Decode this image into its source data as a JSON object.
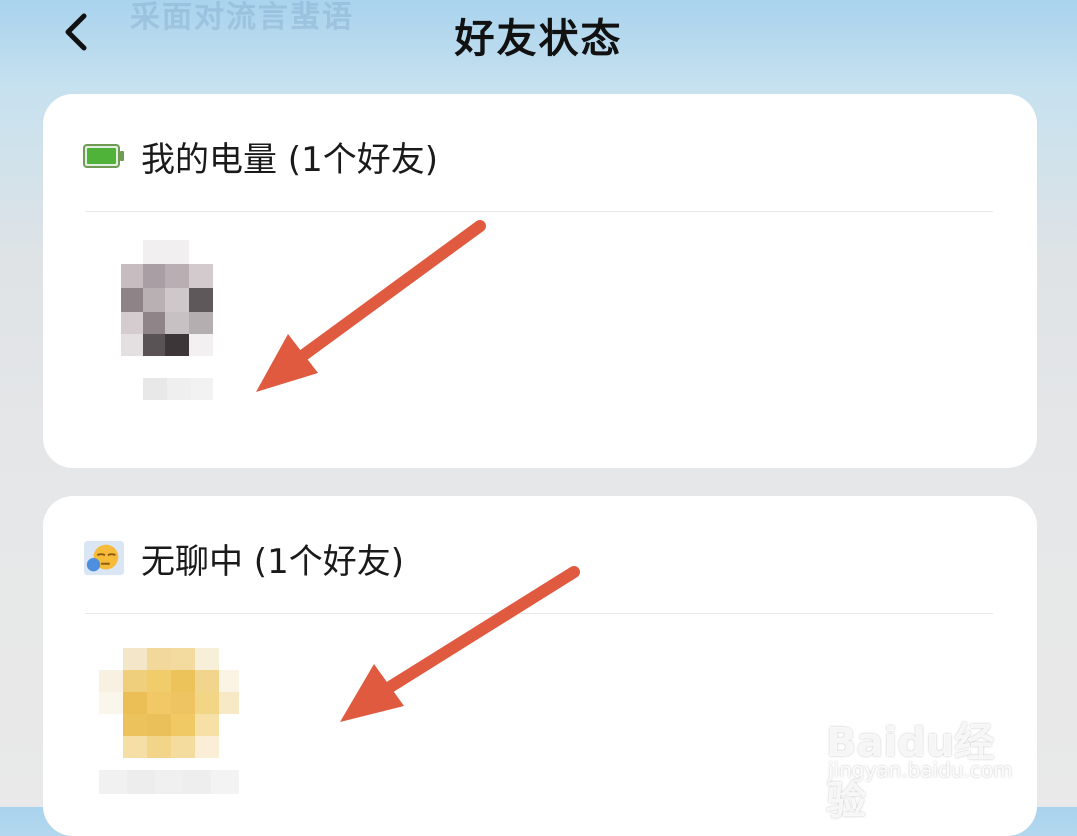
{
  "header": {
    "title": "好友状态",
    "back_icon": "chevron-left-icon",
    "ghost_text": "采面对流言蜚语"
  },
  "sections": [
    {
      "icon": "battery-icon",
      "label": "我的电量 (1个好友)",
      "friend_count": 1
    },
    {
      "icon": "bored-emoji-icon",
      "label": "无聊中 (1个好友)",
      "friend_count": 1
    }
  ],
  "annotation": {
    "arrow_color": "#e05a40"
  },
  "watermark": {
    "brand": "Baidu经验",
    "url": "jingyan.baidu.com"
  }
}
